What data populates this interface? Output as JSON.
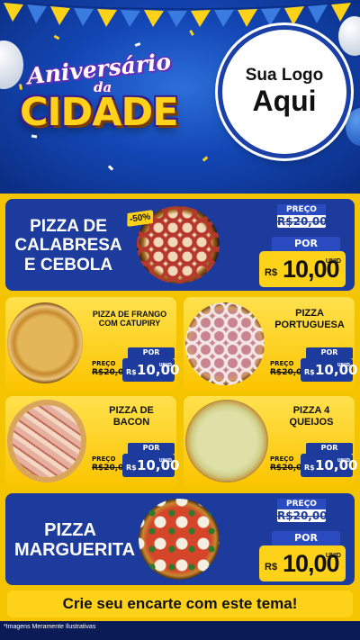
{
  "header": {
    "title_line1": "Aniversário",
    "title_line2": "da",
    "title_line3": "CIDADE",
    "logo_line1": "Sua Logo",
    "logo_line2": "Aqui"
  },
  "colors": {
    "accent_yellow": "#ffd21a",
    "brand_blue": "#1d3b9c"
  },
  "products": [
    {
      "name": "PIZZA DE CALABRESA E CEBOLA",
      "name_lines": [
        "PIZZA DE",
        "CALABRESA",
        "E CEBOLA"
      ],
      "badge": "-50%",
      "price_label": "PREÇO",
      "old_price": "R$20,00",
      "por_label": "POR",
      "currency": "R$",
      "price": "10,00",
      "unit": "UNID"
    },
    {
      "name_lines": [
        "PIZZA DE FRANGO",
        "COM CATUPIRY"
      ],
      "price_label": "PREÇO",
      "old_price": "R$20,00",
      "por_label": "POR",
      "currency": "R$",
      "price": "10,00",
      "unit": "UNID"
    },
    {
      "name_lines": [
        "PIZZA",
        "PORTUGUESA"
      ],
      "price_label": "PREÇO",
      "old_price": "R$20,00",
      "por_label": "POR",
      "currency": "R$",
      "price": "10,00",
      "unit": "UNID"
    },
    {
      "name_lines": [
        "PIZZA DE",
        "BACON"
      ],
      "price_label": "PREÇO",
      "old_price": "R$20,00",
      "por_label": "POR",
      "currency": "R$",
      "price": "10,00",
      "unit": "UNID"
    },
    {
      "name_lines": [
        "PIZZA 4",
        "QUEIJOS"
      ],
      "price_label": "PREÇO",
      "old_price": "R$20,00",
      "por_label": "POR",
      "currency": "R$",
      "price": "10,00",
      "unit": "UNID"
    },
    {
      "name_lines": [
        "PIZZA",
        "MARGUERITA"
      ],
      "price_label": "PREÇO",
      "old_price": "R$20,00",
      "por_label": "POR",
      "currency": "R$",
      "price": "10,00",
      "unit": "UNID"
    }
  ],
  "footer": {
    "cta": "Crie seu encarte com este tema!",
    "disclaimer": "*Imagens Meramente Ilustrativas"
  }
}
